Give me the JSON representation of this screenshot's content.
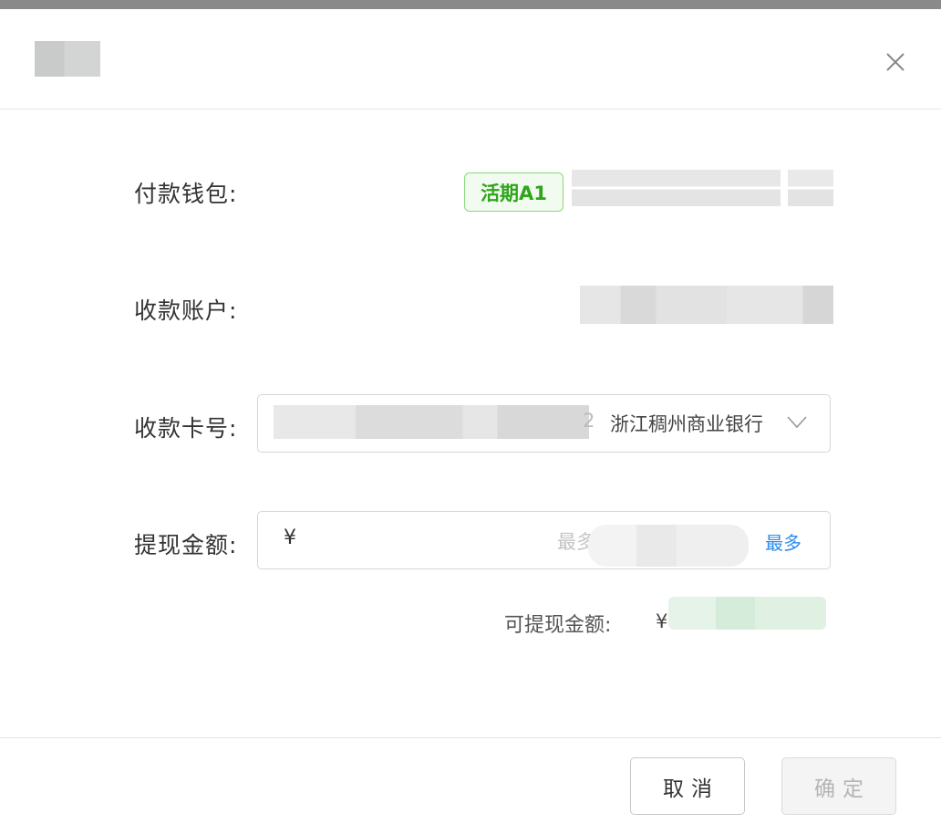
{
  "dialog": {
    "close_icon": "close-icon"
  },
  "form": {
    "wallet_label": "付款钱包:",
    "wallet_tag": "活期A1",
    "account_label": "收款账户:",
    "card_label": "收款卡号:",
    "card_bank": "浙江稠州商业银行",
    "card_tail_digit": "2",
    "amount_label": "提现金额:",
    "amount_currency": "¥",
    "amount_placeholder": "最多",
    "amount_max_link": "最多",
    "available_label": "可提现金额:",
    "available_currency": "¥"
  },
  "footer": {
    "cancel_label": "取消",
    "confirm_label": "确定"
  },
  "colors": {
    "tag_green": "#2fa51b",
    "link_blue": "#2d8cf0"
  }
}
